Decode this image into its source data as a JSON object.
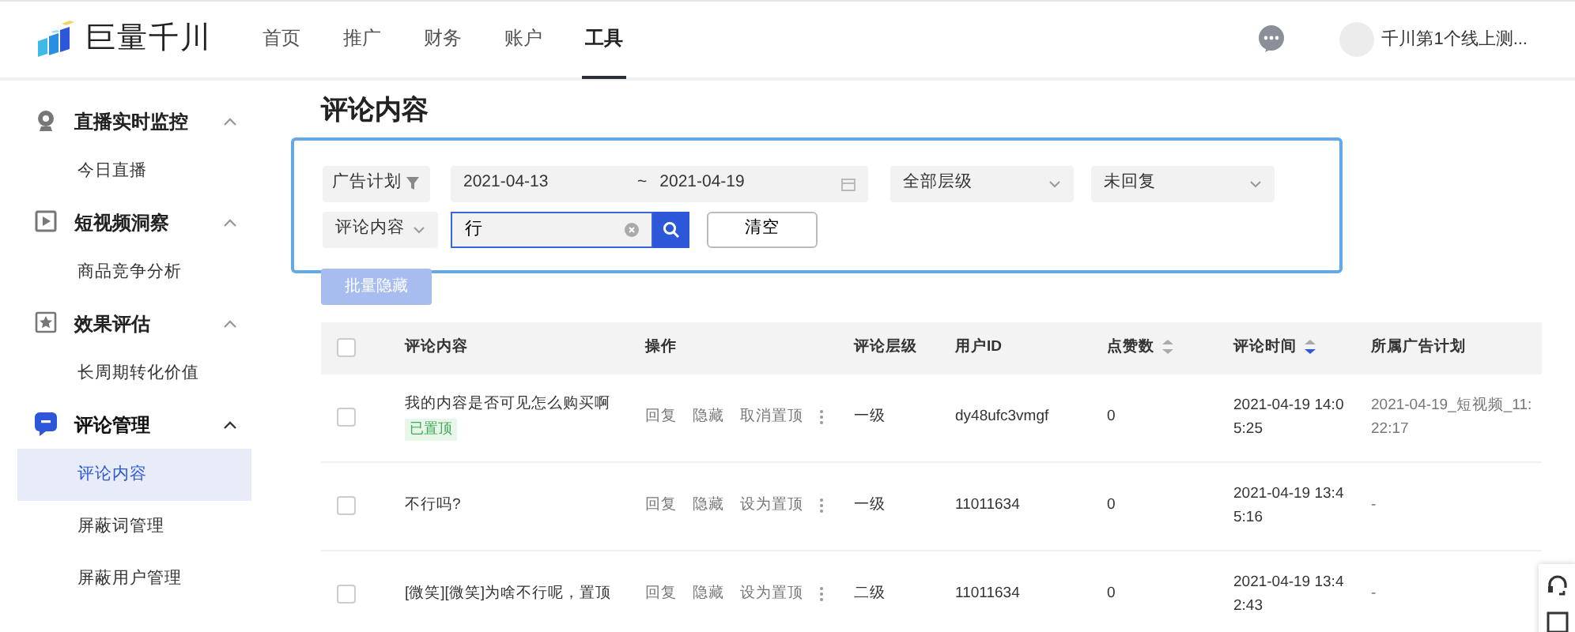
{
  "header": {
    "logo": "巨量千川",
    "nav": [
      {
        "label": "首页",
        "selected": false
      },
      {
        "label": "推广",
        "selected": false
      },
      {
        "label": "财务",
        "selected": false
      },
      {
        "label": "账户",
        "selected": false
      },
      {
        "label": "工具",
        "selected": true
      }
    ],
    "user": "千川第1个线上测..."
  },
  "sidebar": {
    "groups": [
      {
        "label": "直播实时监控",
        "kind": "camera",
        "expanded": true,
        "active": false,
        "items": [
          {
            "label": "今日直播",
            "selected": false
          }
        ]
      },
      {
        "label": "短视频洞察",
        "kind": "video",
        "expanded": true,
        "active": false,
        "items": [
          {
            "label": "商品竞争分析",
            "selected": false
          }
        ]
      },
      {
        "label": "效果评估",
        "kind": "star",
        "expanded": true,
        "active": false,
        "items": [
          {
            "label": "长周期转化价值",
            "selected": false
          }
        ]
      },
      {
        "label": "评论管理",
        "kind": "comment",
        "expanded": true,
        "active": true,
        "items": [
          {
            "label": "评论内容",
            "selected": true
          },
          {
            "label": "屏蔽词管理",
            "selected": false
          },
          {
            "label": "屏蔽用户管理",
            "selected": false
          }
        ]
      }
    ]
  },
  "page_title": "评论内容",
  "filters": {
    "plan_filter": "广告计划",
    "date_start": "2021-04-13",
    "date_separator": "~",
    "date_end": "2021-04-19",
    "level_select": "全部层级",
    "reply_select": "未回复",
    "field_select": "评论内容",
    "search": {
      "value": "行"
    },
    "clear_button": "清空"
  },
  "batch_button": {
    "label": "批量隐藏",
    "disabled": true
  },
  "table": {
    "select_all": {
      "checked": false
    },
    "columns": [
      {
        "label": "评论内容"
      },
      {
        "label": "操作"
      },
      {
        "label": "评论层级"
      },
      {
        "label": "用户ID"
      },
      {
        "label": "点赞数",
        "sorted_desc": false
      },
      {
        "label": "评论时间",
        "sorted_desc": true
      },
      {
        "label": "所属广告计划"
      }
    ],
    "rows": [
      {
        "checked": false,
        "content": "我的内容是否可见怎么购买啊",
        "tag": "已置顶",
        "actions": [
          "回复",
          "隐藏",
          "取消置顶"
        ],
        "level": "一级",
        "user_id": "dy48ufc3vmgf",
        "likes": "0",
        "time": "2021-04-19 14:05:25",
        "plan": "2021-04-19_短视频_11:22:17"
      },
      {
        "checked": false,
        "content": "不行吗?",
        "actions": [
          "回复",
          "隐藏",
          "设为置顶"
        ],
        "level": "一级",
        "user_id": "11011634",
        "likes": "0",
        "time": "2021-04-19 13:45:16",
        "plan": "-"
      },
      {
        "checked": false,
        "content": "[微笑][微笑]为啥不行呢，置顶",
        "actions": [
          "回复",
          "隐藏",
          "设为置顶"
        ],
        "level": "二级",
        "user_id": "11011634",
        "likes": "0",
        "time": "2021-04-19 13:42:43",
        "plan": "-"
      }
    ]
  }
}
